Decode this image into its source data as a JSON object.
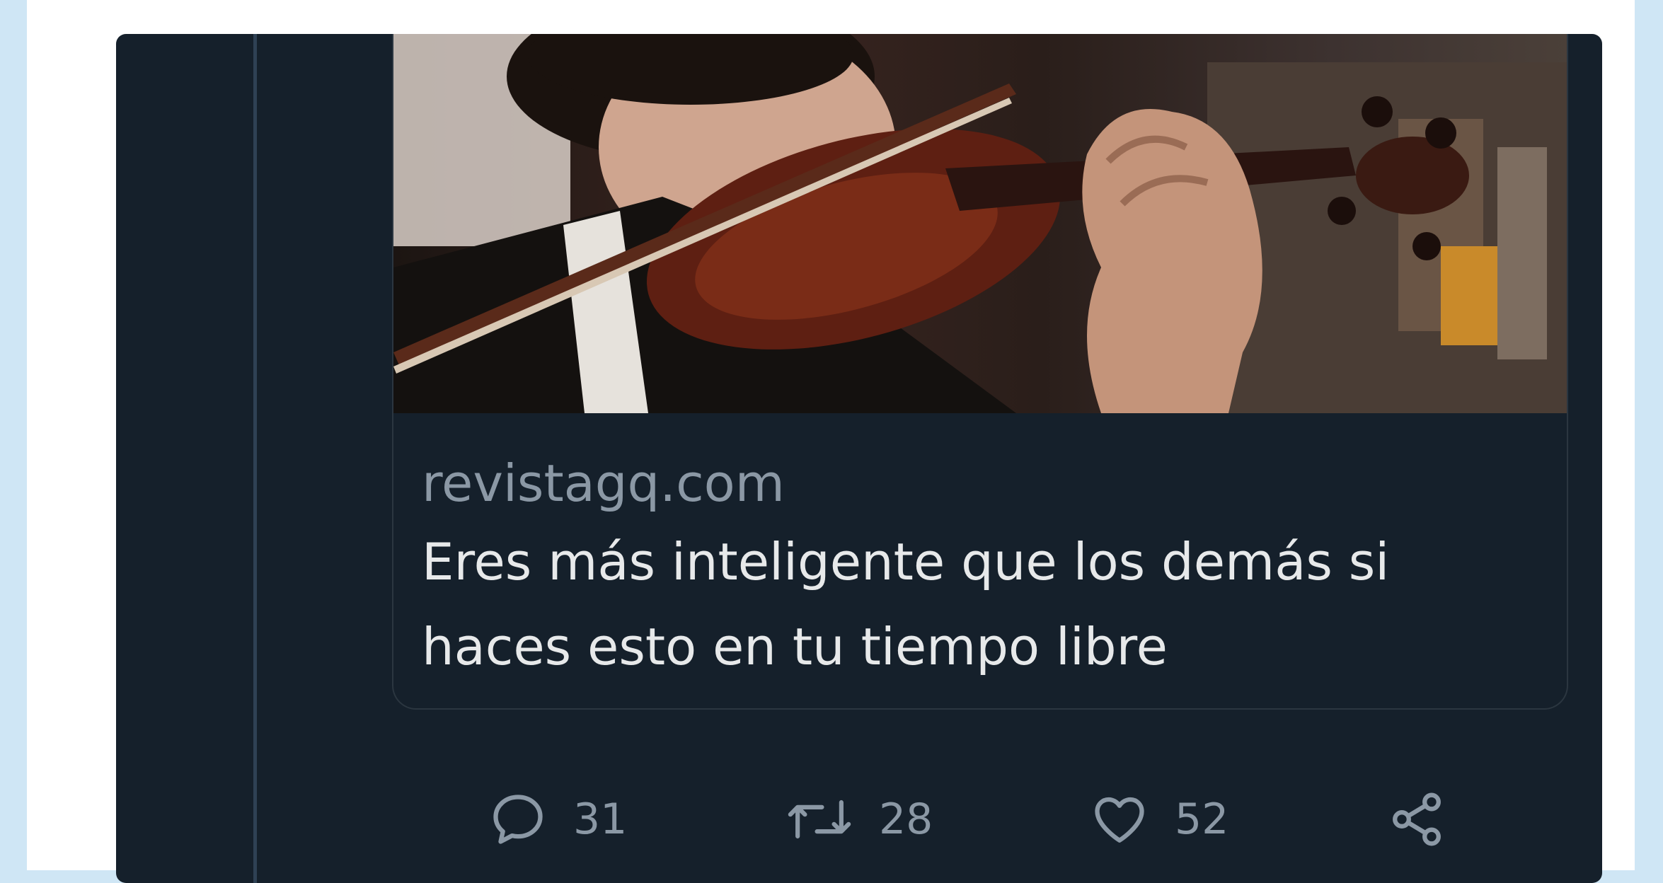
{
  "tweet": {
    "link_card": {
      "image_alt_icon": "violin-player-photo",
      "domain": "revistagq.com",
      "title_line1": "Eres más inteligente que los demás si",
      "title_line2": "haces esto en tu tiempo libre"
    },
    "actions": {
      "reply": {
        "icon": "reply-bubble-icon",
        "count": "31"
      },
      "retweet": {
        "icon": "retweet-icon",
        "count": "28"
      },
      "like": {
        "icon": "heart-icon",
        "count": "52"
      },
      "share": {
        "icon": "share-icon"
      }
    }
  },
  "colors": {
    "card_background": "#15202b",
    "secondary_text": "#8b98a5",
    "primary_text": "#e7e9ea",
    "page_background": "#ffffff",
    "outer_background": "#cfe6f5"
  }
}
